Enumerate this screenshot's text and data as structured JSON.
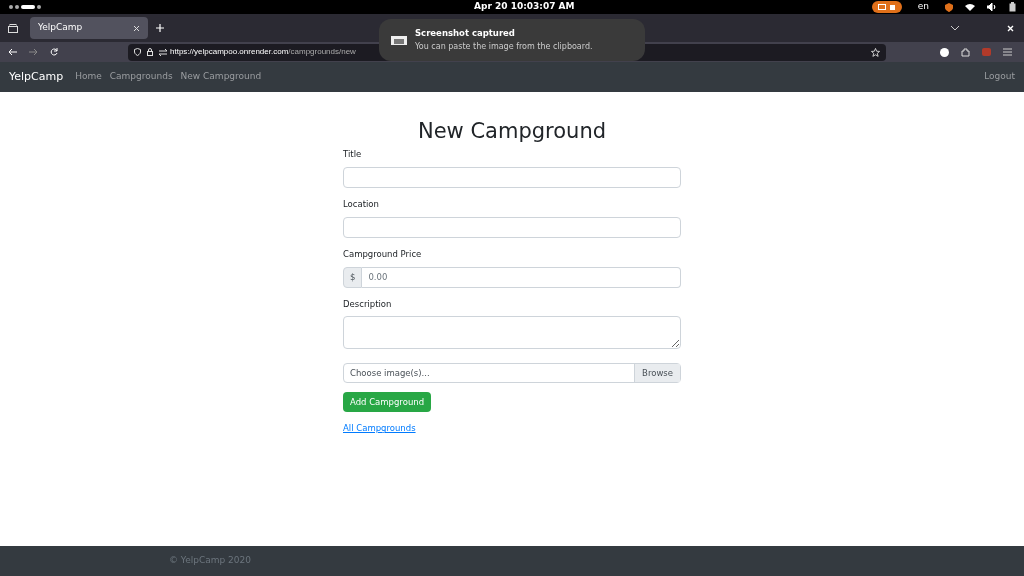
{
  "system_bar": {
    "clock": "Apr 20  10:03:07 AM",
    "language": "en"
  },
  "browser": {
    "tab_title": "YelpCamp",
    "url_host": "https://yelpcampoo.onrender.com",
    "url_path": "/campgrounds/new"
  },
  "notification": {
    "title": "Screenshot captured",
    "message": "You can paste the image from the clipboard."
  },
  "navbar": {
    "brand": "YelpCamp",
    "links": [
      {
        "label": "Home"
      },
      {
        "label": "Campgrounds"
      },
      {
        "label": "New Campground"
      }
    ],
    "logout": "Logout"
  },
  "form": {
    "heading": "New Campground",
    "fields": [
      {
        "kind": "text",
        "label": "Title"
      },
      {
        "kind": "text",
        "label": "Location"
      },
      {
        "kind": "price",
        "label": "Campground Price",
        "prefix": "$",
        "placeholder": "0.00"
      },
      {
        "kind": "textarea",
        "label": "Description"
      }
    ],
    "file_input": {
      "placeholder": "Choose image(s)...",
      "button": "Browse"
    },
    "submit": "Add Campground",
    "back_link": "All Campgrounds"
  },
  "footer": {
    "text": "© YelpCamp 2020"
  }
}
